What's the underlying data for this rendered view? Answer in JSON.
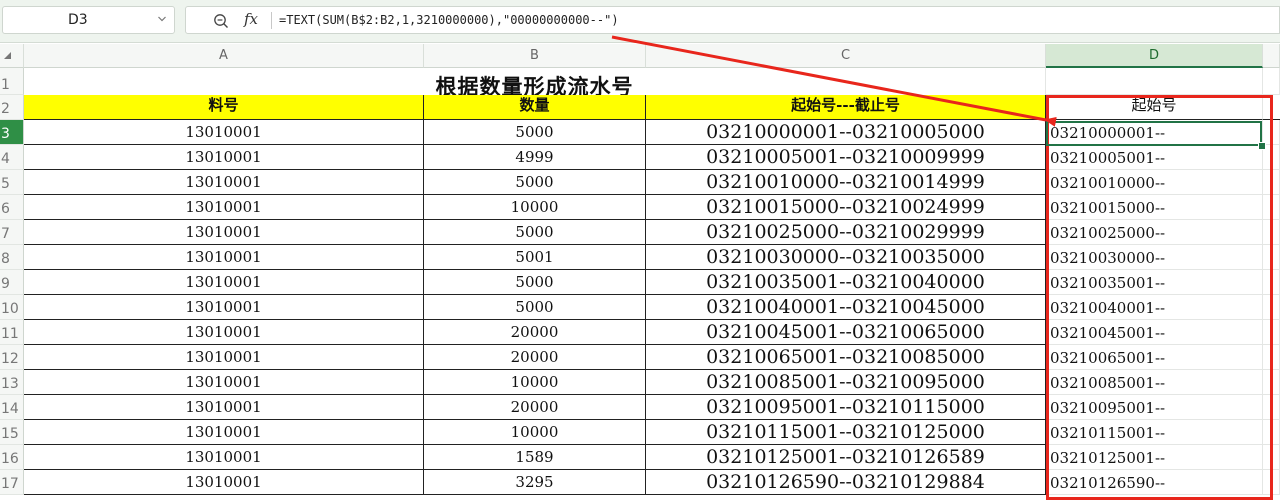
{
  "formula_bar": {
    "name_box": "D3",
    "fx_label": "fx",
    "formula": "=TEXT(SUM(B$2:B2,1,3210000000),\"00000000000--\")"
  },
  "columns": [
    "A",
    "B",
    "C",
    "D"
  ],
  "sheet": {
    "title": "根据数量形成流水号",
    "headers": {
      "A": "料号",
      "B": "数量",
      "C": "起始号---截止号",
      "D": "起始号"
    },
    "rows": [
      {
        "num": "3",
        "part": "13010001",
        "qty": "5000",
        "range": "03210000001--03210005000",
        "start": "03210000001--"
      },
      {
        "num": "4",
        "part": "13010001",
        "qty": "4999",
        "range": "03210005001--03210009999",
        "start": "03210005001--"
      },
      {
        "num": "5",
        "part": "13010001",
        "qty": "5000",
        "range": "03210010000--03210014999",
        "start": "03210010000--"
      },
      {
        "num": "6",
        "part": "13010001",
        "qty": "10000",
        "range": "03210015000--03210024999",
        "start": "03210015000--"
      },
      {
        "num": "7",
        "part": "13010001",
        "qty": "5000",
        "range": "03210025000--03210029999",
        "start": "03210025000--"
      },
      {
        "num": "8",
        "part": "13010001",
        "qty": "5001",
        "range": "03210030000--03210035000",
        "start": "03210030000--"
      },
      {
        "num": "9",
        "part": "13010001",
        "qty": "5000",
        "range": "03210035001--03210040000",
        "start": "03210035001--"
      },
      {
        "num": "10",
        "part": "13010001",
        "qty": "5000",
        "range": "03210040001--03210045000",
        "start": "03210040001--"
      },
      {
        "num": "11",
        "part": "13010001",
        "qty": "20000",
        "range": "03210045001--03210065000",
        "start": "03210045001--"
      },
      {
        "num": "12",
        "part": "13010001",
        "qty": "20000",
        "range": "03210065001--03210085000",
        "start": "03210065001--"
      },
      {
        "num": "13",
        "part": "13010001",
        "qty": "10000",
        "range": "03210085001--03210095000",
        "start": "03210085001--"
      },
      {
        "num": "14",
        "part": "13010001",
        "qty": "20000",
        "range": "03210095001--03210115000",
        "start": "03210095001--"
      },
      {
        "num": "15",
        "part": "13010001",
        "qty": "10000",
        "range": "03210115001--03210125000",
        "start": "03210115001--"
      },
      {
        "num": "16",
        "part": "13010001",
        "qty": "1589",
        "range": "03210125001--03210126589",
        "start": "03210125001--"
      },
      {
        "num": "17",
        "part": "13010001",
        "qty": "3295",
        "range": "03210126590--03210129884",
        "start": "03210126590--"
      }
    ]
  },
  "colors": {
    "header_fill": "#ffff00",
    "selection_green": "#217346",
    "annotation_red": "#e8261c"
  }
}
